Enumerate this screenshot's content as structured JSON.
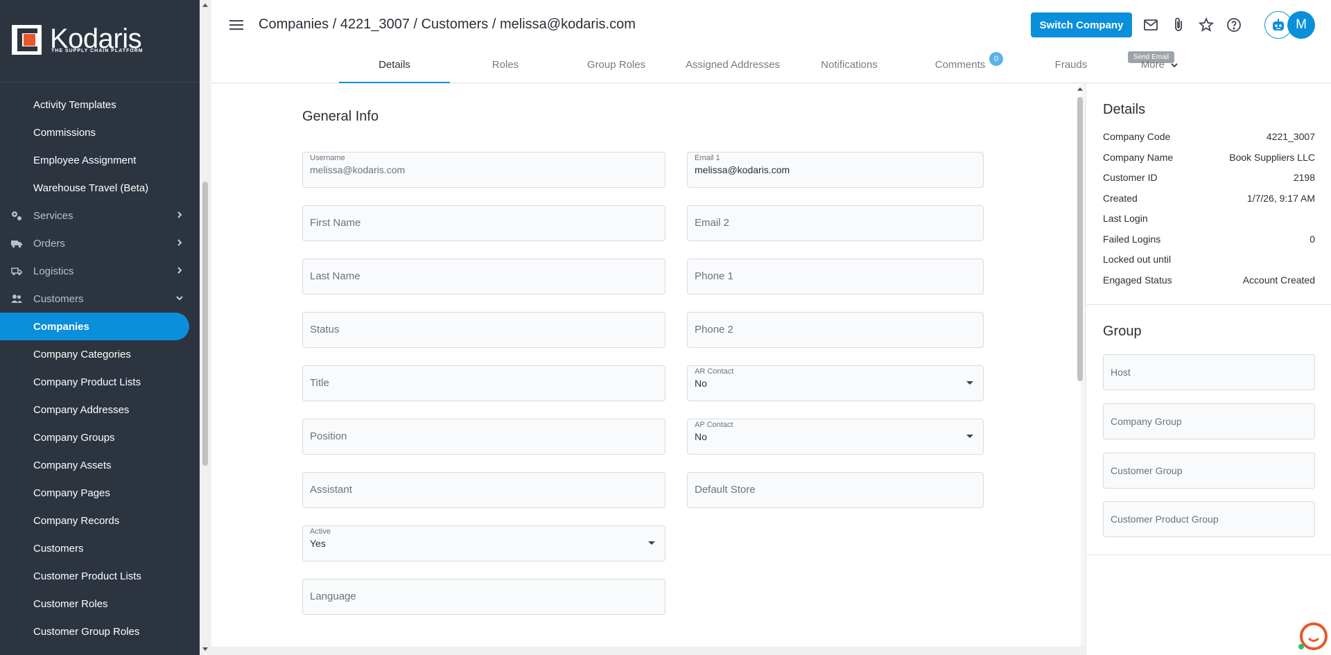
{
  "app": {
    "logo_text": "Kodaris",
    "logo_tagline": "THE SUPPLY CHAIN PLATFORM",
    "brand_color": "#0a8fdb"
  },
  "sidebar": {
    "items": [
      {
        "label": "Activity Templates",
        "type": "sub"
      },
      {
        "label": "Commissions",
        "type": "sub"
      },
      {
        "label": "Employee Assignment",
        "type": "sub"
      },
      {
        "label": "Warehouse Travel (Beta)",
        "type": "sub"
      },
      {
        "label": "Services",
        "type": "section",
        "icon": "gears-icon"
      },
      {
        "label": "Orders",
        "type": "section",
        "icon": "truck-icon"
      },
      {
        "label": "Logistics",
        "type": "section",
        "icon": "delivery-icon"
      },
      {
        "label": "Customers",
        "type": "section",
        "icon": "people-icon"
      },
      {
        "label": "Companies",
        "type": "sub",
        "active": true
      },
      {
        "label": "Company Categories",
        "type": "sub"
      },
      {
        "label": "Company Product Lists",
        "type": "sub"
      },
      {
        "label": "Company Addresses",
        "type": "sub"
      },
      {
        "label": "Company Groups",
        "type": "sub"
      },
      {
        "label": "Company Assets",
        "type": "sub"
      },
      {
        "label": "Company Pages",
        "type": "sub"
      },
      {
        "label": "Company Records",
        "type": "sub"
      },
      {
        "label": "Customers",
        "type": "sub"
      },
      {
        "label": "Customer Product Lists",
        "type": "sub"
      },
      {
        "label": "Customer Roles",
        "type": "sub"
      },
      {
        "label": "Customer Group Roles",
        "type": "sub"
      }
    ]
  },
  "header": {
    "breadcrumb": "Companies / 4221_3007 / Customers / melissa@kodaris.com",
    "switch_company": "Switch Company",
    "tooltip": "Send Email",
    "avatar_initial": "M"
  },
  "tabs": [
    {
      "label": "Details",
      "active": true
    },
    {
      "label": "Roles"
    },
    {
      "label": "Group Roles"
    },
    {
      "label": "Assigned Addresses"
    },
    {
      "label": "Notifications"
    },
    {
      "label": "Comments",
      "badge": "0"
    },
    {
      "label": "Frauds"
    },
    {
      "label": "More"
    }
  ],
  "form": {
    "title": "General Info",
    "username": {
      "label": "Username",
      "value": "melissa@kodaris.com"
    },
    "email1": {
      "label": "Email 1",
      "value": "melissa@kodaris.com"
    },
    "first_name": "First Name",
    "email2": "Email 2",
    "last_name": "Last Name",
    "phone1": "Phone 1",
    "status": "Status",
    "phone2": "Phone 2",
    "title_field": "Title",
    "ar_contact": {
      "label": "AR Contact",
      "value": "No"
    },
    "position": "Position",
    "ap_contact": {
      "label": "AP Contact",
      "value": "No"
    },
    "assistant": "Assistant",
    "default_store": "Default Store",
    "active": {
      "label": "Active",
      "value": "Yes"
    },
    "language": "Language"
  },
  "details": {
    "title": "Details",
    "rows": [
      {
        "key": "Company Code",
        "value": "4221_3007"
      },
      {
        "key": "Company Name",
        "value": "Book Suppliers LLC"
      },
      {
        "key": "Customer ID",
        "value": "2198"
      },
      {
        "key": "Created",
        "value": "1/7/26, 9:17 AM"
      },
      {
        "key": "Last Login",
        "value": ""
      },
      {
        "key": "Failed Logins",
        "value": "0"
      },
      {
        "key": "Locked out until",
        "value": ""
      },
      {
        "key": "Engaged Status",
        "value": "Account Created"
      }
    ]
  },
  "group": {
    "title": "Group",
    "fields": [
      "Host",
      "Company Group",
      "Customer Group",
      "Customer Product Group"
    ]
  }
}
